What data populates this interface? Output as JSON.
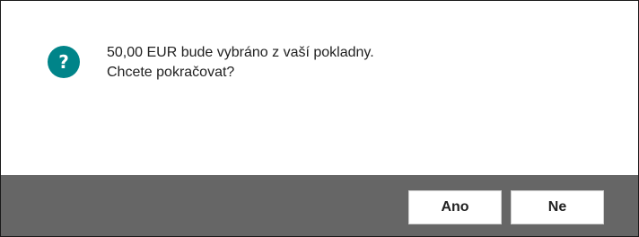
{
  "dialog": {
    "icon": "question-icon",
    "icon_glyph": "?",
    "icon_color": "#008489",
    "message_line1": "50,00 EUR bude vybráno z vaší pokladny.",
    "message_line2": "Chcete pokračovat?",
    "footer_color": "#666666"
  },
  "buttons": {
    "yes_label": "Ano",
    "no_label": "Ne"
  }
}
